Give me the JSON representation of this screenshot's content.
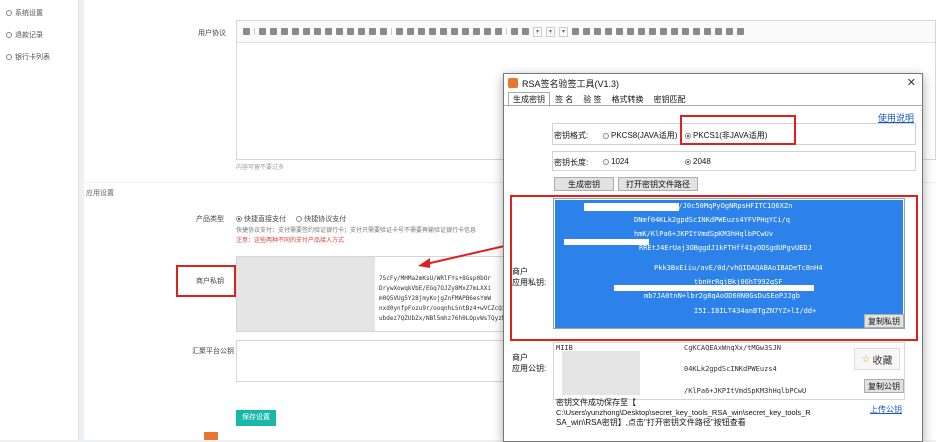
{
  "sidebar": {
    "items": [
      {
        "label": "系统设置",
        "icon": "settings-icon"
      },
      {
        "label": "退款记录",
        "icon": "refund-icon"
      },
      {
        "label": "银行卡列表",
        "icon": "card-icon"
      }
    ]
  },
  "form": {
    "agreement_label": "用户协议",
    "editor_hint": "内容可留不要过多",
    "section_title": "应用设置",
    "product_type_label": "产品类型",
    "option_direct": "快捷直接支付",
    "option_agreement": "快捷协议支付",
    "desc_line": "快捷协议支付：支付需要签约验证银行卡；支付只需要验证卡号不需要再输验证银行卡信息",
    "warn_line": "注意：这些两种不同的支付产品接入方式",
    "merchant_key_label": "商户私钥",
    "merchant_key_partial": [
      "7ScFy/MHMa2mKsU/WRlFYs+8Gsp0bOr",
      "DrywXowqkVbE/EGq7OJZy8MxZ7mLXXi",
      "m0Q5VUg5Y28jmyKojgZnFMAPB6esYmW",
      "nxd0ynfpFozu9r/ooqnhLSntBz4+wVCZcQzJJG",
      "ubdez7QZUbZx/NBl5mhz76h0LOpvWsTQyzMp"
    ],
    "platform_key_label": "汇聚平台公钥",
    "save_label": "保存设置"
  },
  "dialog": {
    "title": "RSA签名验签工具(V1.3)",
    "tabs": [
      "生成密钥",
      "签 名",
      "验 签",
      "格式转换",
      "密钥匹配"
    ],
    "active_tab": 0,
    "help_link": "使用说明",
    "format_label": "密钥格式:",
    "format_option_1": "PKCS8(JAVA适用)",
    "format_option_2": "PKCS1(非JAVA适用)",
    "format_selected": 1,
    "length_label": "密钥长度:",
    "length_option_1": "1024",
    "length_option_2": "2048",
    "length_selected": 1,
    "generate_button": "生成密钥",
    "open_path_button": "打开密钥文件路径",
    "private_key_label_1": "商户",
    "private_key_label_2": "应用私钥:",
    "private_key_visible": [
      "DID5cUN/J0c50MqPyOgNRpsHFITC1Q6XZn",
      "DNmf04KLk2gpdScINKdPWEuzs4YFVPHqYCi/q",
      "hmK/KlPa6+JKPItVmdSpKM3hHqlbPCwUv",
      "RREtJ4ErUaj3OBggdJ1kFTHff41yODSgdUPgvUEDJ",
      "Pkk3BxEiiu/avE/0d/vhQIDAQABAoIBADeTc8nH4",
      "tbnHrRqjBkj06hT992qSF",
      "mb7JA0tnN+lbr2g8qAoOD60N0GsDuSEoPJJgb",
      "I5I.I8ILT434anBTgZN7YZ+lI/dd+"
    ],
    "copy_private_button": "复制私钥",
    "public_key_label_1": "商户",
    "public_key_label_2": "应用公钥:",
    "public_key_visible": [
      "MIIB",
      "CgKCAQEAxWnqXx/tMGw3SJN",
      "04KLk2gpdScINKdPWEuzs4",
      "/KlPa6+JKPItVmdSpKM3hHqlbPCwU"
    ],
    "copy_public_button": "复制公钥",
    "collect_label": "收藏",
    "status_text": [
      "密钥文件成功保存至【",
      "C:\\Users\\yunzhong\\Desktop\\secret_key_tools_RSA_win\\secret_key_tools_R",
      "SA_win\\RSA密钥】,点击\"打开密钥文件路径\"按钮查看"
    ],
    "upload_link": "上传公钥"
  }
}
